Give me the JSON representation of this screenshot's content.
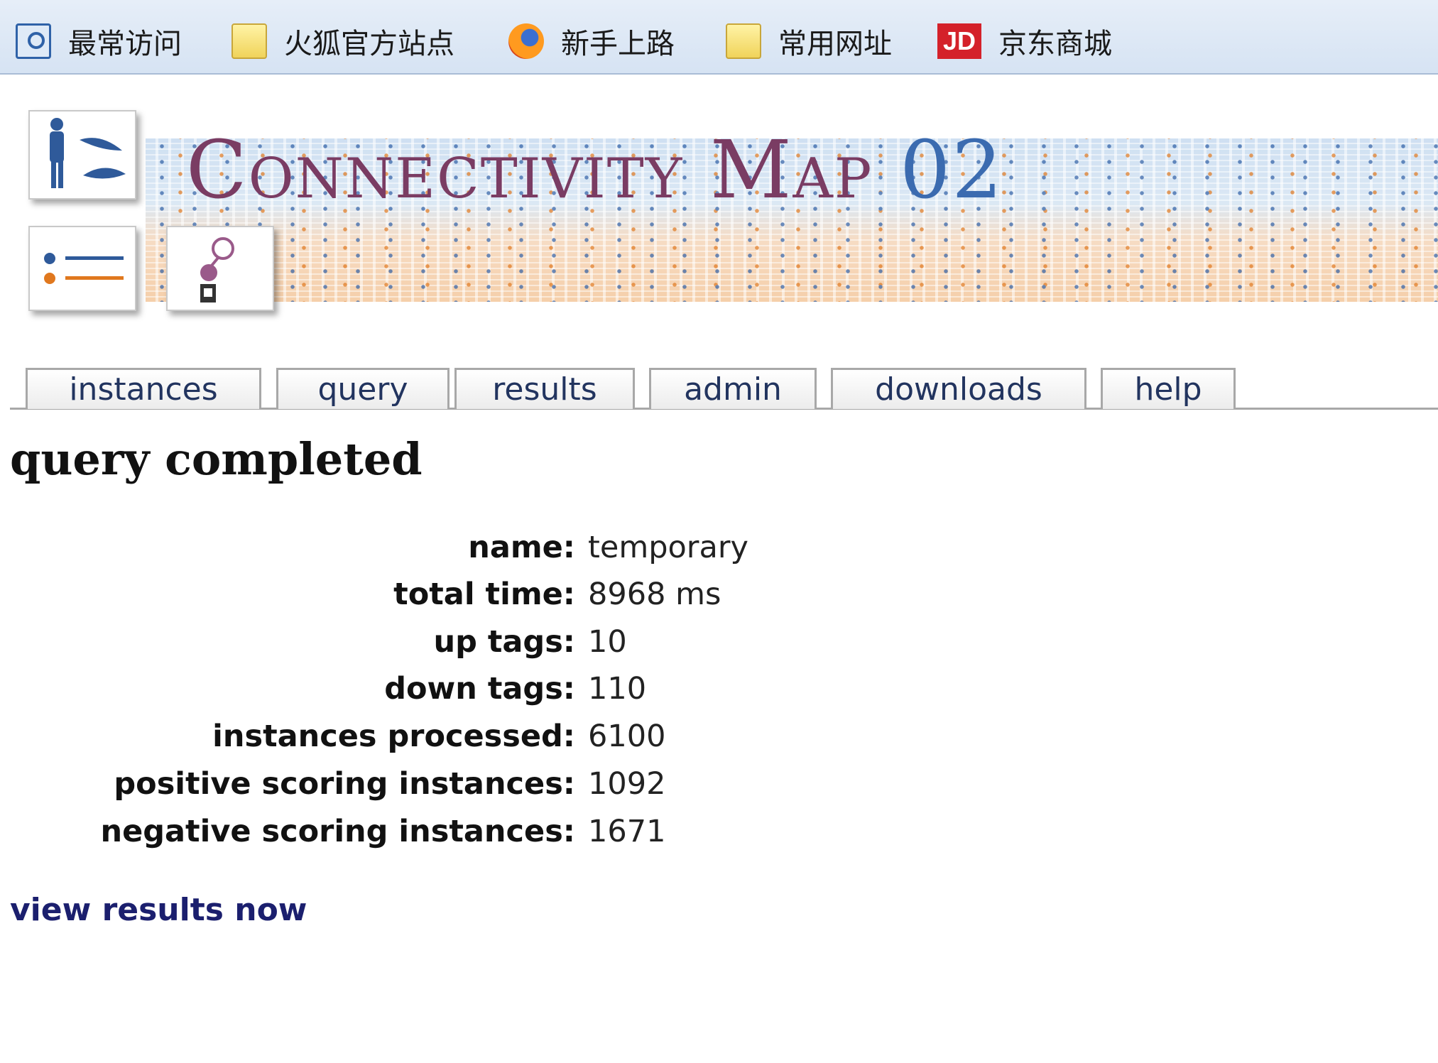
{
  "bookmarks": [
    {
      "label": "最常访问",
      "icon": "search-icon"
    },
    {
      "label": "火狐官方站点",
      "icon": "folder-icon"
    },
    {
      "label": "新手上路",
      "icon": "firefox-icon"
    },
    {
      "label": "常用网址",
      "icon": "folder-icon"
    },
    {
      "label": "京东商城",
      "icon": "jd-logo-icon",
      "badge": "JD"
    }
  ],
  "banner": {
    "title": "Connectivity Map",
    "version": "02"
  },
  "tabs": [
    {
      "label": "instances"
    },
    {
      "label": "query"
    },
    {
      "label": "results"
    },
    {
      "label": "admin"
    },
    {
      "label": "downloads"
    },
    {
      "label": "help"
    }
  ],
  "page": {
    "title": "query completed",
    "stats": [
      {
        "label": "name:",
        "value": "temporary"
      },
      {
        "label": "total time:",
        "value": "8968 ms"
      },
      {
        "label": "up tags:",
        "value": "10"
      },
      {
        "label": "down tags:",
        "value": "110"
      },
      {
        "label": "instances processed:",
        "value": "6100"
      },
      {
        "label": "positive scoring instances:",
        "value": "1092"
      },
      {
        "label": "negative scoring instances:",
        "value": "1671"
      }
    ],
    "link_label": "view results now"
  },
  "colors": {
    "title_purple": "#7a3c63",
    "title_blue": "#3b6bb0",
    "link": "#1b1f6e",
    "jd_red": "#d4212a"
  }
}
